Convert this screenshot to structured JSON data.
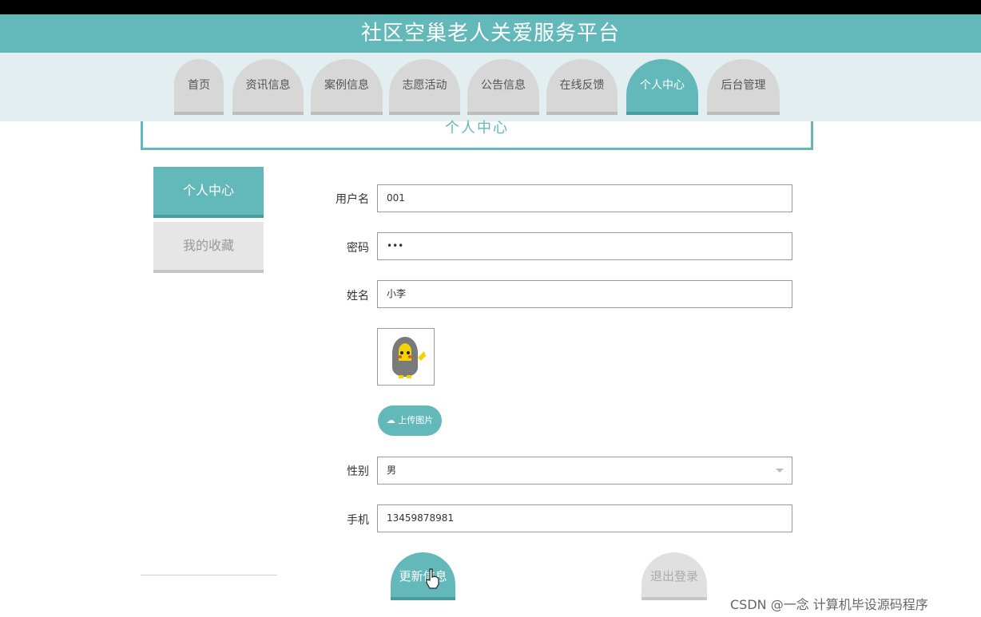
{
  "app": {
    "title": "社区空巢老人关爱服务平台"
  },
  "nav": {
    "items": [
      {
        "label": "首页"
      },
      {
        "label": "资讯信息"
      },
      {
        "label": "案例信息"
      },
      {
        "label": "志愿活动"
      },
      {
        "label": "公告信息"
      },
      {
        "label": "在线反馈"
      },
      {
        "label": "个人中心"
      },
      {
        "label": "后台管理"
      }
    ],
    "active": "个人中心"
  },
  "page": {
    "title": "个人中心"
  },
  "sidebar": {
    "items": [
      {
        "label": "个人中心"
      },
      {
        "label": "我的收藏"
      }
    ],
    "active": "个人中心"
  },
  "form": {
    "username": {
      "label": "用户名",
      "value": "001"
    },
    "password": {
      "label": "密码",
      "value": "•••"
    },
    "name": {
      "label": "姓名",
      "value": "小李"
    },
    "upload_label": "上传图片",
    "gender": {
      "label": "性别",
      "value": "男"
    },
    "phone": {
      "label": "手机",
      "value": "13459878981"
    }
  },
  "actions": {
    "update": "更新信息",
    "logout": "退出登录"
  },
  "watermark": "CSDN @一念 计算机毕设源码程序",
  "colors": {
    "accent": "#63b9b9",
    "inactive": "#d7d7d7",
    "band": "#e3eef1"
  }
}
